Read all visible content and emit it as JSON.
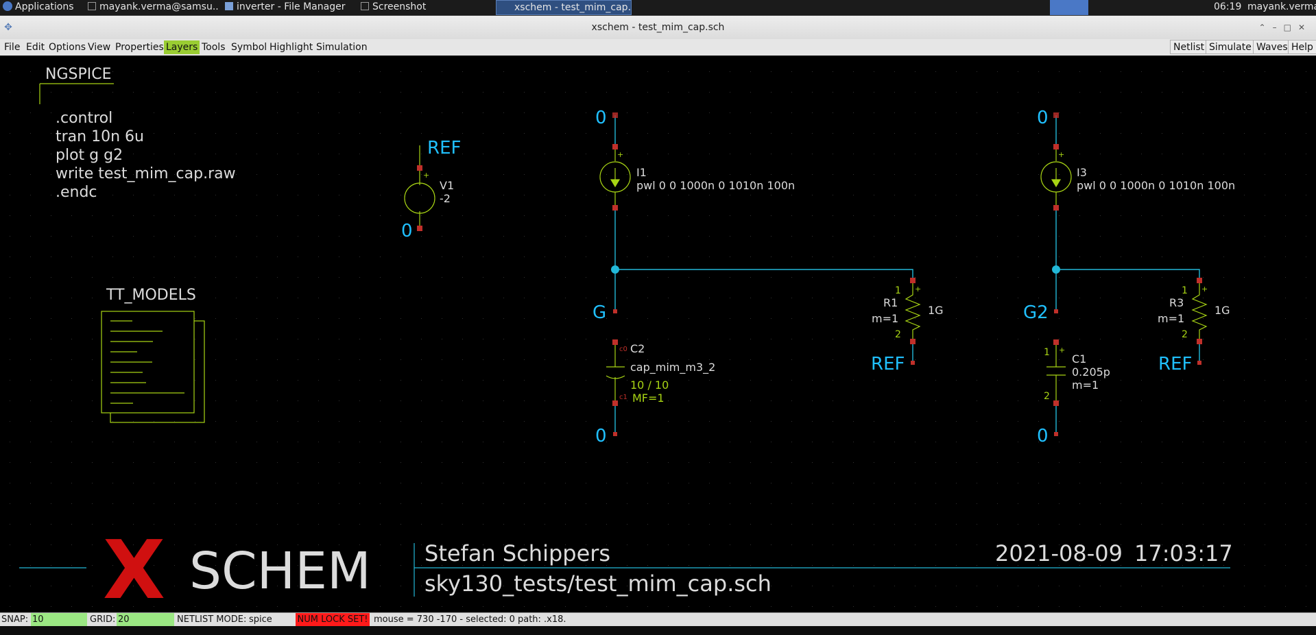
{
  "taskbar": {
    "applications": "Applications",
    "items": [
      "mayank.verma@samsu...",
      "inverter - File Manager",
      "Screenshot",
      "xschem - test_mim_cap..."
    ],
    "clock": "06:19",
    "user": "mayank.verma"
  },
  "window": {
    "title": "xschem - test_mim_cap.sch"
  },
  "menu": {
    "items": [
      "File",
      "Edit",
      "Options",
      "View",
      "Properties",
      "Layers",
      "Tools",
      "Symbol",
      "Highlight",
      "Simulation"
    ],
    "active": "Layers",
    "right_buttons": [
      "Netlist",
      "Simulate",
      "Waves",
      "Help"
    ]
  },
  "schematic": {
    "ngspice_label": "NGSPICE",
    "control_lines": [
      ".control",
      "tran 10n 6u",
      "plot g g2",
      "write test_mim_cap.raw",
      ".endc"
    ],
    "models_label": "TT_MODELS",
    "v1": {
      "name": "V1",
      "value": "-2",
      "net_top": "REF",
      "net_bottom": "0"
    },
    "i1": {
      "name": "I1",
      "value": "pwl 0 0 1000n 0 1010n 100n",
      "net_top": "0"
    },
    "i3": {
      "name": "I3",
      "value": "pwl 0 0 1000n 0 1010n 100n",
      "net_top": "0"
    },
    "net_g": "G",
    "net_g2": "G2",
    "c2": {
      "name": "C2",
      "model": "cap_mim_m3_2",
      "size": "10 / 10",
      "mf": "MF=1",
      "pin_top": "c0",
      "pin_bottom": "c1",
      "net_bottom": "0"
    },
    "c1": {
      "name": "C1",
      "value": "0.205p",
      "m": "m=1",
      "pin_top": "1",
      "pin_bottom": "2",
      "net_bottom": "0"
    },
    "r1": {
      "name": "R1",
      "m": "m=1",
      "value": "1G",
      "pin_top": "1",
      "pin_bottom": "2",
      "net_bottom": "REF"
    },
    "r3": {
      "name": "R3",
      "m": "m=1",
      "value": "1G",
      "pin_top": "1",
      "pin_bottom": "2",
      "net_bottom": "REF"
    },
    "title_block": {
      "logo_x": "X",
      "logo_rest": "SCHEM",
      "author": "Stefan Schippers",
      "date": "2021-08-09",
      "time": "17:03:17",
      "path": "sky130_tests/test_mim_cap.sch"
    }
  },
  "status": {
    "snap_label": "SNAP:",
    "snap_value": "10",
    "grid_label": "GRID:",
    "grid_value": "20",
    "netlist_label": "NETLIST MODE:",
    "netlist_value": "spice",
    "numlock": "NUM LOCK SET!",
    "info": "mouse = 730 -170 - selected: 0 path: .x18."
  },
  "colors": {
    "wire": "#22b8d8",
    "symbol": "#a8d414",
    "pin": "#c0302a",
    "net_label": "#20c0ff",
    "text": "#dcdcdc",
    "logo_red": "#d01010",
    "menu_active": "#9acd32"
  }
}
